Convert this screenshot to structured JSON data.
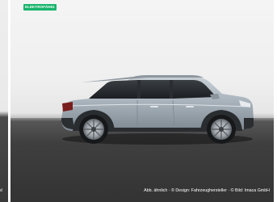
{
  "gallery": {
    "badge_label": "ELEKTROFÄHIG",
    "current_caption": "Abb. ähnlich · © Design: Fahrzeughersteller · © Bild: Imaca GmbH",
    "prev_caption": "d"
  },
  "colors": {
    "badge_bg": "#18b36b",
    "car_paint": "#a9b3bc",
    "floor": "#3a3a3a",
    "backdrop": "#efefef"
  },
  "icons": {
    "car_image": "suv-side-view-image"
  }
}
